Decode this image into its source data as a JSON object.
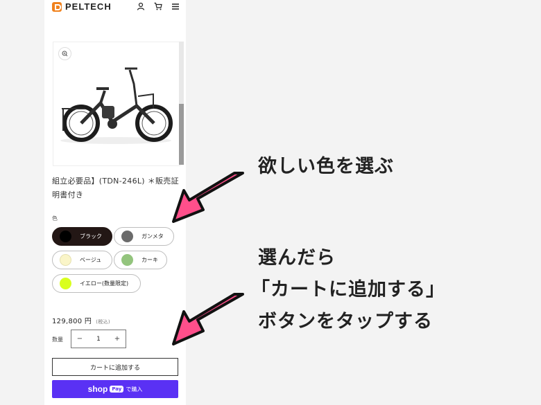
{
  "header": {
    "brand": "PELTECH",
    "icons": [
      "user-icon",
      "cart-icon",
      "menu-icon"
    ]
  },
  "gallery": {
    "image": "electric-folding-bike",
    "zoom_icon": "zoom-icon"
  },
  "product": {
    "title": "組立必要品】(TDN-246L) ＊販売証明書付き"
  },
  "options": {
    "label": "色",
    "colors": [
      {
        "label": "ブラック",
        "color": "#000000",
        "selected": true
      },
      {
        "label": "ガンメタ",
        "color": "#6b6b6b",
        "selected": false
      },
      {
        "label": "ベージュ",
        "color": "#faf5c8",
        "selected": false
      },
      {
        "label": "カーキ",
        "color": "#93c47d",
        "selected": false
      },
      {
        "label": "イエロー(数量限定)",
        "color": "#d9ff1e",
        "selected": false
      }
    ]
  },
  "price": {
    "amount": "129,800 円",
    "tax_note": "(税込)"
  },
  "quantity": {
    "label": "数量",
    "value": "1",
    "minus": "−",
    "plus": "+"
  },
  "buttons": {
    "add_to_cart": "カートに追加する",
    "shop_word": "shop",
    "shop_pay_chip": "Pay",
    "shop_suffix": "で購入"
  },
  "annotations": {
    "pick_color": "欲しい色を選ぶ",
    "line1": "選んだら",
    "line2": "「カートに追加する」",
    "line3": "ボタンをタップする",
    "arrow_color": "#ff4f8b"
  }
}
